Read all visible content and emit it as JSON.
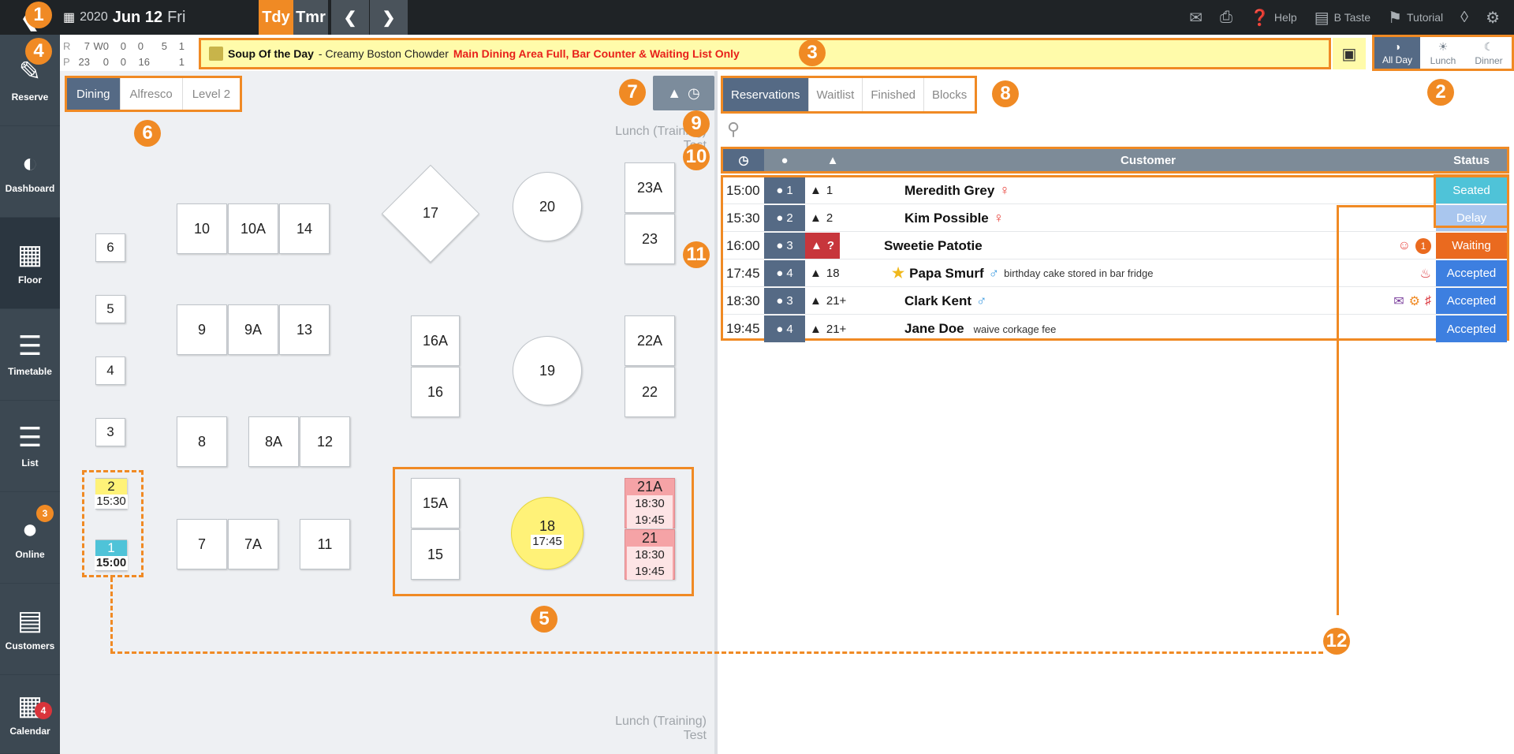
{
  "topbar": {
    "year": "2020",
    "month_day": "Jun 12",
    "weekday": "Fri",
    "today_label": "Tdy",
    "tomorrow_label": "Tmr",
    "prev_icon": "chevron-left-icon",
    "next_icon": "chevron-right-icon",
    "help_label": "Help",
    "restaurant_label": "B Taste",
    "tutorial_label": "Tutorial"
  },
  "sidebar": {
    "items": [
      {
        "label": "Reserve",
        "icon": "reserve-icon"
      },
      {
        "label": "Dashboard",
        "icon": "dashboard-icon"
      },
      {
        "label": "Floor",
        "icon": "floor-icon"
      },
      {
        "label": "Timetable",
        "icon": "timetable-icon"
      },
      {
        "label": "List",
        "icon": "list-icon"
      },
      {
        "label": "Online",
        "icon": "online-icon",
        "badge": "3"
      },
      {
        "label": "Customers",
        "icon": "customers-icon"
      },
      {
        "label": "Calendar",
        "icon": "calendar-icon",
        "badge": "4"
      }
    ]
  },
  "stats": {
    "row_r": {
      "label": "R",
      "values": [
        "7",
        "W0",
        "0",
        "0",
        "5",
        "1"
      ]
    },
    "row_p": {
      "label": "P",
      "values": [
        "23",
        "0",
        "0",
        "16",
        "1"
      ]
    }
  },
  "notice": {
    "title": "Soup Of the Day",
    "text": "- Creamy Boston Chowder",
    "alert": "Main Dining Area Full, Bar Counter & Waiting List Only"
  },
  "periods": [
    {
      "label": "All Day",
      "active": true
    },
    {
      "label": "Lunch",
      "active": false
    },
    {
      "label": "Dinner",
      "active": false
    }
  ],
  "floor": {
    "tabs": [
      "Dining",
      "Alfresco",
      "Level 2"
    ],
    "shift_label_top_1": "Lunch (Training)",
    "shift_label_top_2": "Test",
    "shift_label_bottom_1": "Lunch (Training)",
    "shift_label_bottom_2": "Test",
    "tables": {
      "t6": "6",
      "t5": "5",
      "t4": "4",
      "t3": "3",
      "t2": "2",
      "t2_time": "15:30",
      "t1": "1",
      "t1_time": "15:00",
      "t10": "10",
      "t10a": "10A",
      "t14": "14",
      "t9": "9",
      "t9a": "9A",
      "t13": "13",
      "t8": "8",
      "t8a": "8A",
      "t12": "12",
      "t7": "7",
      "t7a": "7A",
      "t11": "11",
      "t17": "17",
      "t20": "20",
      "t19": "19",
      "t16a": "16A",
      "t16": "16",
      "t15a": "15A",
      "t15": "15",
      "t18": "18",
      "t18_time": "17:45",
      "t23a": "23A",
      "t23": "23",
      "t22a": "22A",
      "t22": "22",
      "t21a": "21A",
      "t21a_t1": "18:30",
      "t21a_t2": "19:45",
      "t21": "21",
      "t21_t1": "18:30",
      "t21_t2": "19:45"
    }
  },
  "reservations": {
    "tabs": [
      "Reservations",
      "Waitlist",
      "Finished",
      "Blocks"
    ],
    "search_placeholder": "",
    "headers": {
      "customer": "Customer",
      "status": "Status"
    },
    "rows": [
      {
        "time": "15:00",
        "pax": "1",
        "table": "1",
        "name": "Meredith Grey",
        "note": "",
        "status": "Seated"
      },
      {
        "time": "15:30",
        "pax": "2",
        "table": "2",
        "name": "Kim Possible",
        "note": "",
        "status": "Delay"
      },
      {
        "time": "16:00",
        "pax": "3",
        "table": "?",
        "name": "Sweetie Patotie",
        "note": "",
        "status": "Waiting",
        "count": "1"
      },
      {
        "time": "17:45",
        "pax": "4",
        "table": "18",
        "name": "Papa Smurf",
        "note": "birthday cake stored in bar fridge",
        "status": "Accepted"
      },
      {
        "time": "18:30",
        "pax": "3",
        "table": "21+",
        "name": "Clark Kent",
        "note": "",
        "status": "Accepted"
      },
      {
        "time": "19:45",
        "pax": "4",
        "table": "21+",
        "name": "Jane Doe",
        "note": "waive corkage fee",
        "status": "Accepted"
      }
    ]
  },
  "callouts": [
    "1",
    "2",
    "3",
    "4",
    "5",
    "6",
    "7",
    "8",
    "9",
    "10",
    "11",
    "12"
  ],
  "colors": {
    "accent": "#f08a24",
    "topbar": "#1f2326",
    "sidebar": "#3c4852",
    "active_tab": "#556a85",
    "seated": "#4fc3d8",
    "delay": "#a9c6ee",
    "waiting": "#ea6a1f",
    "accepted": "#3d7fe0"
  }
}
